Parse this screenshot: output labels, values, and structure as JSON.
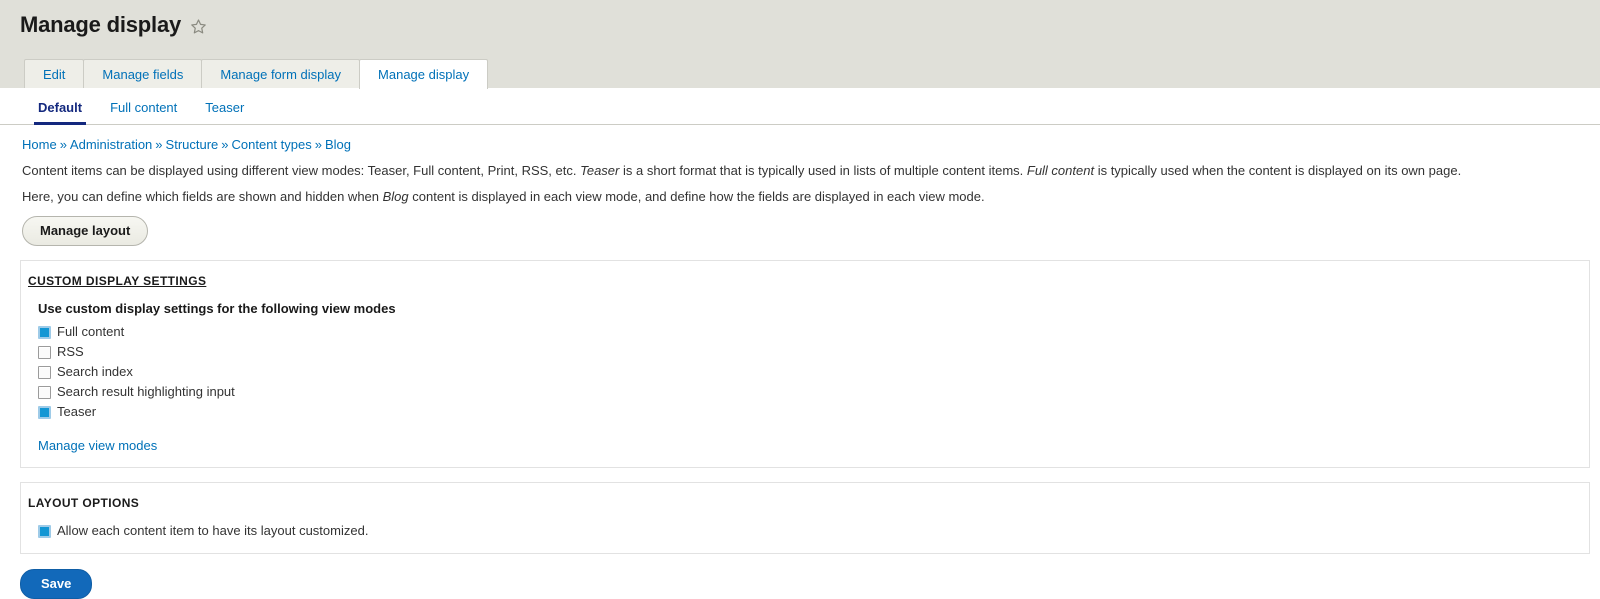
{
  "header": {
    "title": "Manage display",
    "star_icon": "star-outline-icon"
  },
  "primary_tabs": [
    {
      "label": "Edit",
      "active": false
    },
    {
      "label": "Manage fields",
      "active": false
    },
    {
      "label": "Manage form display",
      "active": false
    },
    {
      "label": "Manage display",
      "active": true
    }
  ],
  "secondary_tabs": [
    {
      "label": "Default",
      "active": true
    },
    {
      "label": "Full content",
      "active": false
    },
    {
      "label": "Teaser",
      "active": false
    }
  ],
  "breadcrumb": {
    "separator": "»",
    "items": [
      "Home",
      "Administration",
      "Structure",
      "Content types",
      "Blog"
    ]
  },
  "description": {
    "paragraph1_part1": "Content items can be displayed using different view modes: Teaser, Full content, Print, RSS, etc. ",
    "paragraph1_em1": "Teaser",
    "paragraph1_part2": " is a short format that is typically used in lists of multiple content items. ",
    "paragraph1_em2": "Full content",
    "paragraph1_part3": " is typically used when the content is displayed on its own page.",
    "paragraph2_part1": "Here, you can define which fields are shown and hidden when ",
    "paragraph2_em1": "Blog",
    "paragraph2_part2": " content is displayed in each view mode, and define how the fields are displayed in each view mode."
  },
  "manage_layout_button": "Manage layout",
  "custom_display_settings": {
    "title": "CUSTOM DISPLAY SETTINGS",
    "field_label": "Use custom display settings for the following view modes",
    "options": [
      {
        "label": "Full content",
        "checked": true
      },
      {
        "label": "RSS",
        "checked": false
      },
      {
        "label": "Search index",
        "checked": false
      },
      {
        "label": "Search result highlighting input",
        "checked": false
      },
      {
        "label": "Teaser",
        "checked": true
      }
    ],
    "manage_view_modes_link": "Manage view modes"
  },
  "layout_options": {
    "title": "LAYOUT OPTIONS",
    "option": {
      "label": "Allow each content item to have its layout customized.",
      "checked": true
    }
  },
  "save_button": "Save",
  "colors": {
    "header_band": "#e0e0d9",
    "link": "#0071b8",
    "active_subtab": "#13287e",
    "checkbox_checked": "#1296d4",
    "save_button": "#1269ba"
  }
}
